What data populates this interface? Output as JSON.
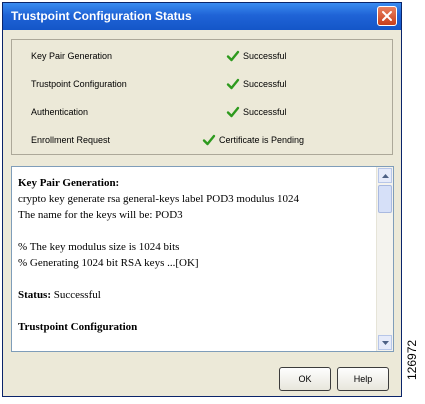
{
  "window": {
    "title": "Trustpoint Configuration Status",
    "close_icon": "close-icon",
    "title_bar_color": "#1f63d6",
    "close_button_color": "#d8532c"
  },
  "status_rows": [
    {
      "label": "Key Pair Generation",
      "status": "Successful",
      "icon": "check-icon"
    },
    {
      "label": "Trustpoint Configuration",
      "status": "Successful",
      "icon": "check-icon"
    },
    {
      "label": "Authentication",
      "status": "Successful",
      "icon": "check-icon"
    },
    {
      "label": "Enrollment Request",
      "status": "Certificate is Pending",
      "icon": "check-icon"
    }
  ],
  "check_color": "#2e9a1e",
  "log": {
    "section1_heading": "Key Pair Generation:",
    "line1": "crypto key generate rsa general-keys label POD3 modulus 1024",
    "line2": "The name for the keys will be: POD3",
    "line3": "% The key modulus size is 1024 bits",
    "line4": "% Generating 1024 bit RSA keys ...[OK]",
    "status_label": "Status:",
    "status_value": "Successful",
    "section2_heading": "Trustpoint Configuration"
  },
  "buttons": {
    "ok": "OK",
    "help": "Help"
  },
  "figure_number": "126972"
}
